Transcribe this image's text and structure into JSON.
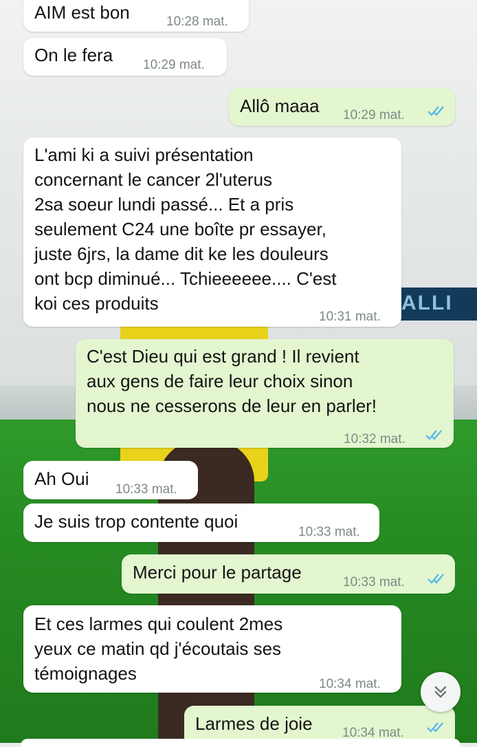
{
  "messages": [
    {
      "dir": "in",
      "text": "AIM est bon",
      "time": "10:28 mat."
    },
    {
      "dir": "in",
      "text": "On le fera",
      "time": "10:29 mat."
    },
    {
      "dir": "out",
      "text": "Allô maaa",
      "time": "10:29 mat.",
      "status": "read"
    },
    {
      "dir": "in",
      "text": "L'ami ki a suivi présentation\nconcernant le cancer 2l'uterus\n2sa soeur lundi passé... Et a pris\nseulement C24 une boîte pr essayer,\njuste 6jrs, la dame dit ke les douleurs\nont bcp diminué... Tchieeeeee.... C'est\nkoi ces produits",
      "time": "10:31 mat."
    },
    {
      "dir": "out",
      "text": "C'est Dieu qui est grand ! Il revient\naux gens de faire leur choix sinon\nnous ne cesserons de leur en parler!",
      "time": "10:32 mat.",
      "status": "read"
    },
    {
      "dir": "in",
      "text": "Ah Oui",
      "time": "10:33 mat."
    },
    {
      "dir": "in",
      "text": "Je suis trop contente quoi",
      "time": "10:33 mat."
    },
    {
      "dir": "out",
      "text": "Merci pour le partage",
      "time": "10:33 mat.",
      "status": "read"
    },
    {
      "dir": "in",
      "text": "Et ces larmes qui coulent 2mes\nyeux ce matin qd j'écoutais ses\ntémoignages",
      "time": "10:34 mat."
    },
    {
      "dir": "out",
      "text": "Larmes de joie",
      "time": "10:34 mat.",
      "status": "read"
    }
  ],
  "background_logo_text": "ALLI",
  "icons": {
    "read_receipt": "double-check-icon",
    "scroll_down": "double-chevron-down-icon"
  },
  "colors": {
    "incoming": "#ffffff",
    "outgoing": "#e3f6cf",
    "ticks": "#4fb6ec",
    "timestamp": "#7d8a86"
  }
}
